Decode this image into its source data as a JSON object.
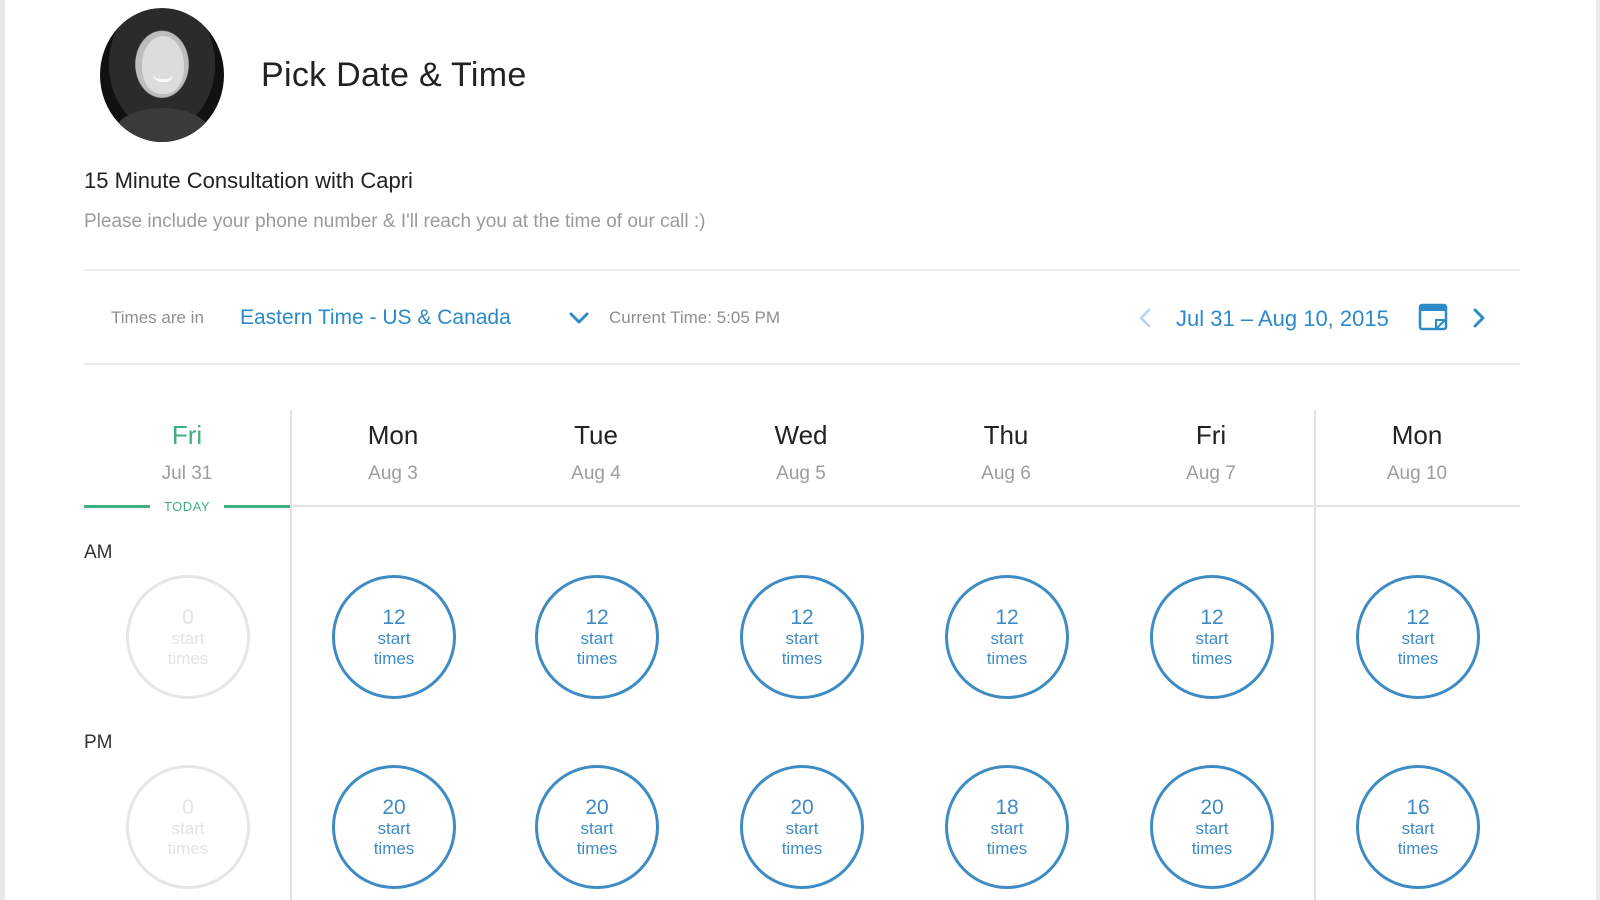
{
  "header": {
    "title": "Pick Date & Time",
    "avatar": "profile-photo"
  },
  "event": {
    "name": "15 Minute Consultation with Capri",
    "description": "Please include your phone number & I'll reach you at the time of our call :)"
  },
  "toolbar": {
    "timezone_label": "Times are in",
    "timezone_value": "Eastern Time - US & Canada",
    "current_time": "Current Time: 5:05 PM",
    "date_range": "Jul 31 – Aug 10, 2015",
    "prev_icon": "chevron-left-icon",
    "next_icon": "chevron-right-icon",
    "calendar_icon": "calendar-icon"
  },
  "today_label": "TODAY",
  "periods": {
    "am": "AM",
    "pm": "PM"
  },
  "slot_unit": {
    "line1": "start",
    "line2": "times"
  },
  "days": [
    {
      "name": "Fri",
      "date": "Jul 31",
      "am": "0",
      "pm": "0"
    },
    {
      "name": "Mon",
      "date": "Aug 3",
      "am": "12",
      "pm": "20"
    },
    {
      "name": "Tue",
      "date": "Aug 4",
      "am": "12",
      "pm": "20"
    },
    {
      "name": "Wed",
      "date": "Aug 5",
      "am": "12",
      "pm": "20"
    },
    {
      "name": "Thu",
      "date": "Aug 6",
      "am": "12",
      "pm": "18"
    },
    {
      "name": "Fri",
      "date": "Aug 7",
      "am": "12",
      "pm": "20"
    },
    {
      "name": "Mon",
      "date": "Aug 10",
      "am": "12",
      "pm": "16"
    }
  ],
  "colors": {
    "accent": "#2b8ac7",
    "slot_border": "#3f8cc4",
    "today": "#3fb07d",
    "disabled": "#e6e6e6"
  }
}
